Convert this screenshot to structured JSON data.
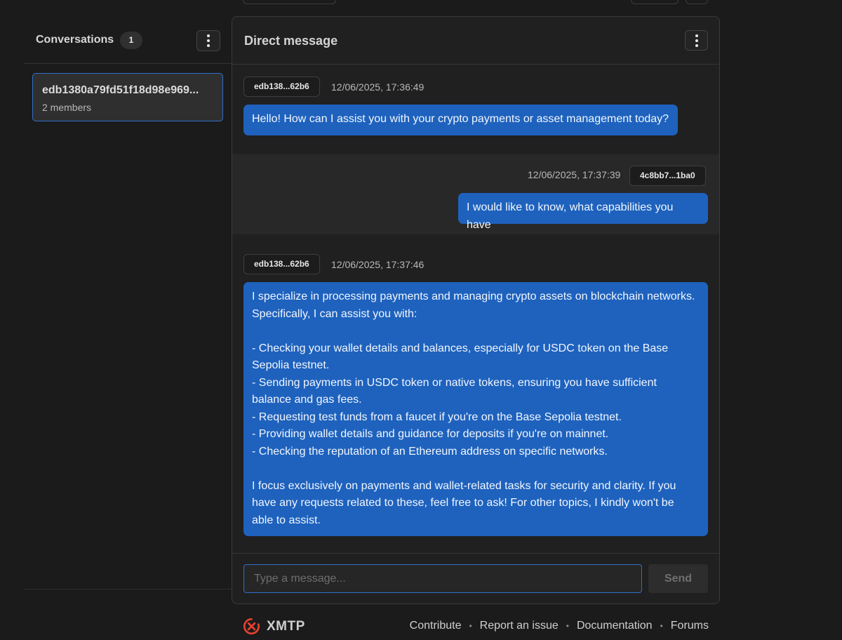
{
  "sidebar": {
    "title": "Conversations",
    "count": "1",
    "conversations": [
      {
        "name": "edb1380a79fd51f18d98e969...",
        "members": "2 members"
      }
    ]
  },
  "panel": {
    "title": "Direct message",
    "messages": [
      {
        "sender": "edb138...62b6",
        "time": "12/06/2025, 17:36:49",
        "text": "Hello! How can I assist you with your crypto payments or asset management today?"
      },
      {
        "sender": "4c8bb7...1ba0",
        "time": "12/06/2025, 17:37:39",
        "text": "I would like to know, what capabilities you have"
      },
      {
        "sender": "edb138...62b6",
        "time": "12/06/2025, 17:37:46",
        "text": "I specialize in processing payments and managing crypto assets on blockchain networks.\nSpecifically, I can assist you with:\n\n- Checking your wallet details and balances, especially for USDC token on the Base\nSepolia testnet.\n- Sending payments in USDC token or native tokens, ensuring you have sufficient\nbalance and gas fees.\n- Requesting test funds from a faucet if you're on the Base Sepolia testnet.\n- Providing wallet details and guidance for deposits if you're on mainnet.\n- Checking the reputation of an Ethereum address on specific networks.\n\nI focus exclusively on payments and wallet-related tasks for security and clarity. If you\nhave any requests related to these, feel free to ask! For other topics, I kindly won't be\nable to assist."
      }
    ],
    "composer": {
      "placeholder": "Type a message...",
      "value": "",
      "send_label": "Send"
    }
  },
  "footer": {
    "brand": "XMTP",
    "links": [
      "Contribute",
      "Report an issue",
      "Documentation",
      "Forums"
    ]
  },
  "colors": {
    "accent": "#1e62be",
    "focus_border": "#2f6fc7",
    "brand_logo": "#e5412f",
    "background": "#1b1b1b"
  },
  "icons": {
    "menu": "kebab-vertical-icon",
    "brand": "xmtp-logo-icon"
  }
}
